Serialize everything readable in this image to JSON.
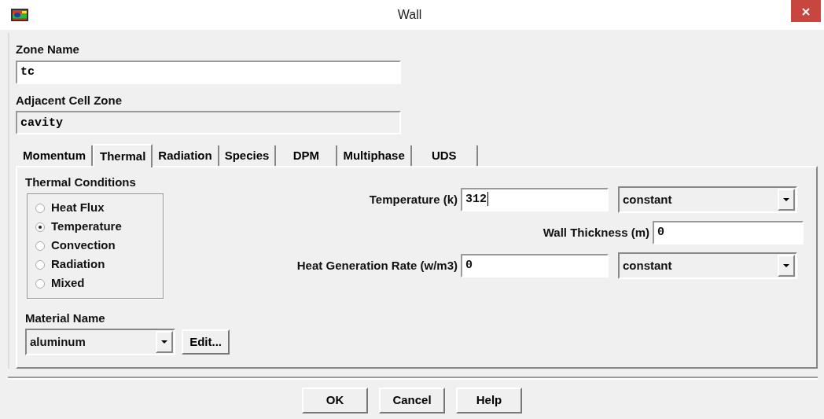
{
  "window": {
    "title": "Wall"
  },
  "zone_name": {
    "label": "Zone Name",
    "value": "tc"
  },
  "adjacent_cell_zone": {
    "label": "Adjacent Cell Zone",
    "value": "cavity",
    "disabled": true
  },
  "tabs": [
    {
      "label": "Momentum",
      "selected": false
    },
    {
      "label": "Thermal",
      "selected": true
    },
    {
      "label": "Radiation",
      "selected": false
    },
    {
      "label": "Species",
      "selected": false
    },
    {
      "label": "DPM",
      "selected": false
    },
    {
      "label": "Multiphase",
      "selected": false
    },
    {
      "label": "UDS",
      "selected": false
    }
  ],
  "thermal_conditions": {
    "label": "Thermal Conditions",
    "options": [
      {
        "label": "Heat Flux",
        "selected": false
      },
      {
        "label": "Temperature",
        "selected": true
      },
      {
        "label": "Convection",
        "selected": false
      },
      {
        "label": "Radiation",
        "selected": false
      },
      {
        "label": "Mixed",
        "selected": false
      }
    ]
  },
  "fields": [
    {
      "label": "Temperature (k)",
      "value": "312",
      "focused": true,
      "dropdown": "constant"
    },
    {
      "label": "Wall Thickness (m)",
      "value": "0",
      "focused": false
    },
    {
      "label": "Heat Generation Rate (w/m3)",
      "value": "0",
      "focused": false,
      "dropdown": "constant"
    }
  ],
  "material": {
    "label": "Material Name",
    "value": "aluminum",
    "button": "Edit..."
  },
  "buttons": [
    "OK",
    "Cancel",
    "Help"
  ]
}
